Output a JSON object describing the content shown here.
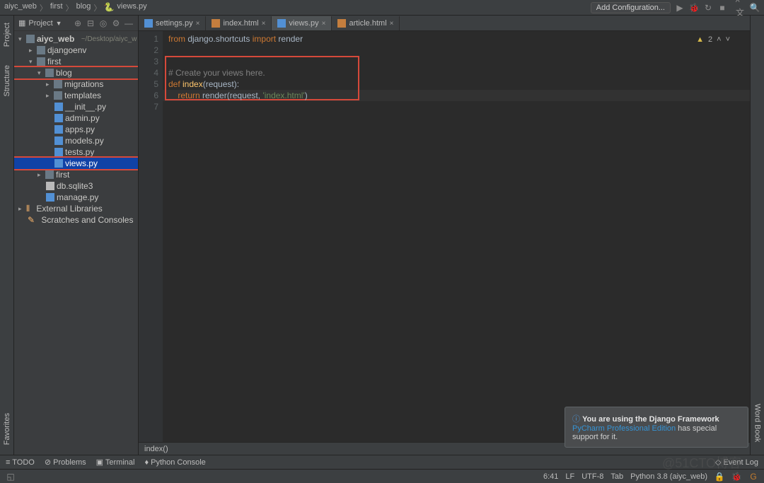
{
  "breadcrumb": {
    "project": "aiyc_web",
    "p1": "first",
    "p2": "blog",
    "file": "views.py"
  },
  "nav": {
    "addConfig": "Add Configuration..."
  },
  "sidebar": {
    "title": "Project",
    "root": "aiyc_web",
    "rootPath": "~/Desktop/aiyc_w",
    "items": {
      "djangoenv": "djangoenv",
      "first": "first",
      "blog": "blog",
      "migrations": "migrations",
      "templates": "templates",
      "init": "__init__.py",
      "admin": "admin.py",
      "apps": "apps.py",
      "models": "models.py",
      "tests": "tests.py",
      "views": "views.py",
      "first2": "first",
      "db": "db.sqlite3",
      "manage": "manage.py",
      "extlib": "External Libraries",
      "scratch": "Scratches and Consoles"
    }
  },
  "tabs": {
    "settings": "settings.py",
    "index": "index.html",
    "views": "views.py",
    "article": "article.html"
  },
  "code": {
    "ln": [
      "1",
      "2",
      "3",
      "4",
      "5",
      "6",
      "7"
    ],
    "l1_kw1": "from",
    "l1_mod": " django.shortcuts ",
    "l1_kw2": "import",
    "l1_name": " render",
    "l4_cm": "# Create your views here.",
    "l5_kw": "def ",
    "l5_fn": "index",
    "l5_par": "(request):",
    "l6_ind": "    ",
    "l6_kw": "return",
    "l6_fn": " render",
    "l6_args1": "(request, ",
    "l6_str": "'index.html'",
    "l6_args2": ")"
  },
  "warn": {
    "label": "2"
  },
  "crumbs": {
    "c1": "index()"
  },
  "bottom": {
    "todo": "TODO",
    "problems": "Problems",
    "terminal": "Terminal",
    "python": "Python Console",
    "eventlog": "Event Log"
  },
  "status": {
    "pos": "6:41",
    "lf": "LF",
    "enc": "UTF-8",
    "tab": "Tab",
    "python": "Python 3.8 (aiyc_web)"
  },
  "notif": {
    "title": "You are using the Django Framework",
    "link": "PyCharm Professional Edition",
    "rest": " has special support for it."
  },
  "rails": {
    "project": "Project",
    "structure": "Structure",
    "favorites": "Favorites",
    "wordbook": "Word Book"
  },
  "watermark": "@51CTO博客"
}
